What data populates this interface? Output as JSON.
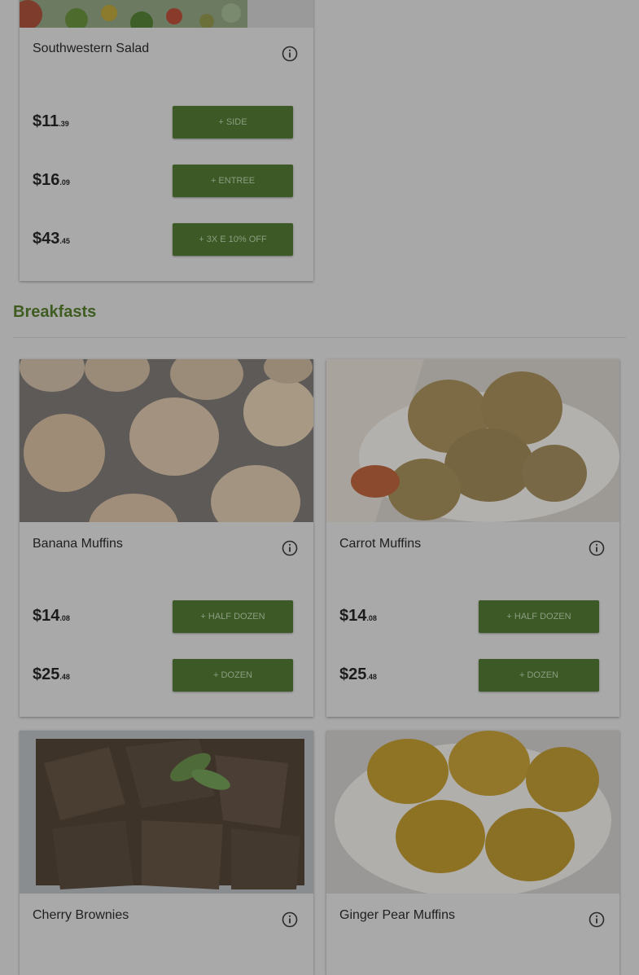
{
  "sections": {
    "breakfasts_title": "Breakfasts"
  },
  "cards": {
    "southwestern_salad": {
      "title": "Southwestern Salad",
      "options": [
        {
          "dollars": "$11",
          "cents": ".39",
          "button": "+ SIDE"
        },
        {
          "dollars": "$16",
          "cents": ".09",
          "button": "+ ENTREE"
        },
        {
          "dollars": "$43",
          "cents": ".45",
          "button": "+ 3X E 10% OFF"
        }
      ]
    },
    "banana_muffins": {
      "title": "Banana Muffins",
      "options": [
        {
          "dollars": "$14",
          "cents": ".08",
          "button": "+ HALF DOZEN"
        },
        {
          "dollars": "$25",
          "cents": ".48",
          "button": "+ DOZEN"
        }
      ]
    },
    "carrot_muffins": {
      "title": "Carrot Muffins",
      "options": [
        {
          "dollars": "$14",
          "cents": ".08",
          "button": "+ HALF DOZEN"
        },
        {
          "dollars": "$25",
          "cents": ".48",
          "button": "+ DOZEN"
        }
      ]
    },
    "cherry_brownies": {
      "title": "Cherry Brownies"
    },
    "ginger_pear_muffins": {
      "title": "Ginger Pear Muffins"
    }
  },
  "icons": {
    "info": "info-circle-icon"
  },
  "colors": {
    "accent_green": "#3f5c21",
    "button_green": "#3d5a26",
    "overlay_gray": "#a8a8a8"
  }
}
